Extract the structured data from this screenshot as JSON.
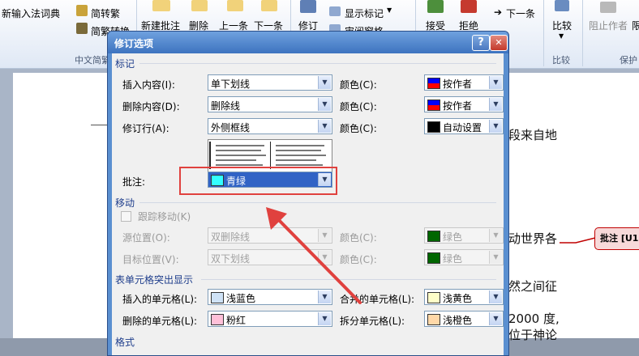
{
  "ribbon": {
    "ime_dict": "新输入法词典",
    "trad_to_simp": "简转繁",
    "simp_to_trad": "简繁转换",
    "group_chinese": "中文简繁",
    "new_comment": "新建批注",
    "delete": "删除",
    "prev": "上一条",
    "next": "下一条",
    "track": "修订",
    "show_markup": "显示标记",
    "review_pane": "审阅窗格",
    "accept": "接受",
    "reject": "拒绝",
    "next_change": "下一条",
    "compare": "比较",
    "group_compare": "比较",
    "block_authors": "阻止作者",
    "group_protect": "保护",
    "cut_text": "限"
  },
  "document": {
    "text1": "段来自地",
    "text2": "动世界各",
    "text3": "然之间征",
    "text4": "2000 度,",
    "text5": "位于神论",
    "balloon": "批注 [U1"
  },
  "dialog": {
    "title": "修订选项",
    "help": "?",
    "close": "✕",
    "markup_section": "标记",
    "insertions_label": "插入内容(I):",
    "insertions_value": "单下划线",
    "deletions_label": "删除内容(D):",
    "deletions_value": "删除线",
    "changed_lines_label": "修订行(A):",
    "changed_lines_value": "外侧框线",
    "color_label": "颜色(C):",
    "color_by_author": "按作者",
    "color_auto": "自动设置",
    "comments_label": "批注:",
    "comments_value": "青绿",
    "moves_section": "移动",
    "track_moves": "跟踪移动(K)",
    "moved_from_label": "源位置(O):",
    "moved_from_value": "双删除线",
    "moved_to_label": "目标位置(V):",
    "moved_to_value": "双下划线",
    "green": "绿色",
    "table_section": "表单元格突出显示",
    "inserted_cells_label": "插入的单元格(L):",
    "inserted_cells_value": "浅蓝色",
    "deleted_cells_label": "删除的单元格(L):",
    "deleted_cells_value": "粉红",
    "merged_cells_label": "合并的单元格(L):",
    "merged_cells_value": "浅黄色",
    "split_cells_label": "拆分单元格(L):",
    "split_cells_value": "浅橙色",
    "format_section": "格式"
  },
  "colors": {
    "accent_blue": "#3d73bf",
    "highlight_red": "#e0413e",
    "selection": "#3163c5",
    "teal": "#33ffff",
    "green": "#006600",
    "light_blue": "#cfe2f6",
    "pink": "#ffc0d8",
    "light_yellow": "#ffffc8",
    "light_orange": "#ffd8a8"
  }
}
